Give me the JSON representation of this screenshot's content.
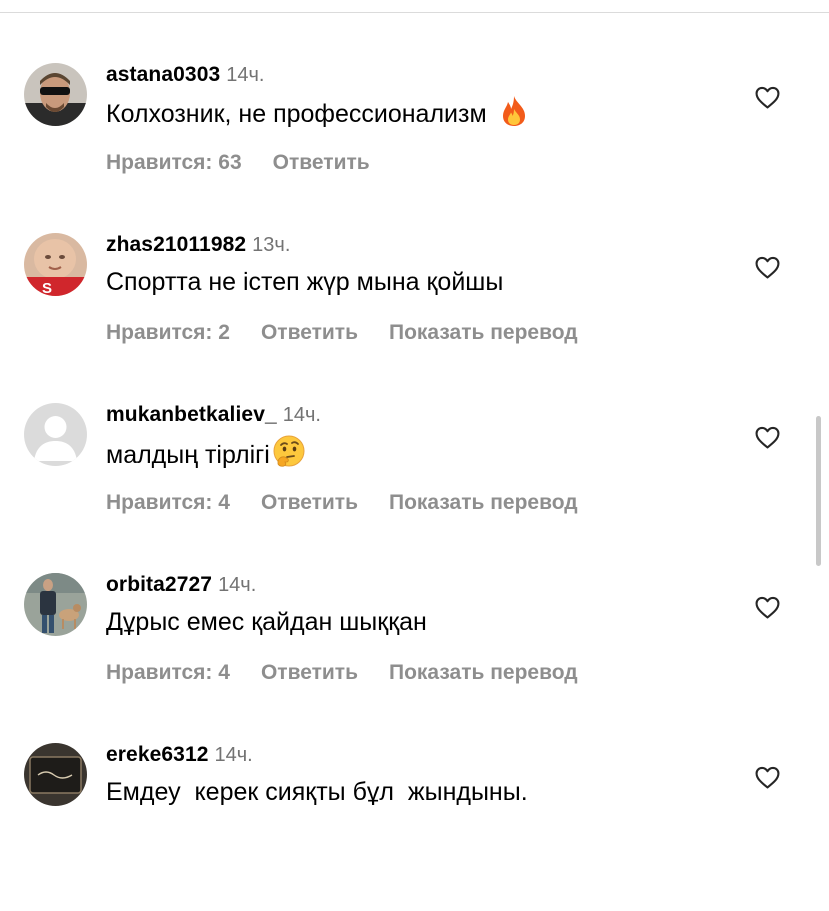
{
  "comments": [
    {
      "username": "astana0303",
      "time": "14ч.",
      "text": "Колхозник, не профессионализм",
      "emoji": "fire-emoji",
      "likes": "Нравится: 63",
      "reply": "Ответить",
      "translate": ""
    },
    {
      "username": "zhas21011982",
      "time": "13ч.",
      "text": "Спортта не істеп жүр мына қойшы",
      "emoji": "",
      "likes": "Нравится: 2",
      "reply": "Ответить",
      "translate": "Показать перевод"
    },
    {
      "username": "mukanbetkaliev_",
      "time": "14ч.",
      "text": "малдың тірлігі",
      "emoji": "thinking-face-emoji",
      "likes": "Нравится: 4",
      "reply": "Ответить",
      "translate": "Показать перевод"
    },
    {
      "username": "orbita2727",
      "time": "14ч.",
      "text": "Дұрыс емес қайдан шыққан",
      "emoji": "",
      "likes": "Нравится: 4",
      "reply": "Ответить",
      "translate": "Показать перевод"
    },
    {
      "username": "ereke6312",
      "time": "14ч.",
      "text": "Емдеу  керек сияқты бұл  жындыны.",
      "emoji": "",
      "likes": "",
      "reply": "",
      "translate": ""
    }
  ],
  "icons": {
    "like": "heart-outline-icon",
    "default_avatar": "default-avatar-icon"
  },
  "colors": {
    "text": "#000000",
    "secondary": "#8e8e8e",
    "time": "#737373",
    "divider": "#dbdbdb"
  }
}
